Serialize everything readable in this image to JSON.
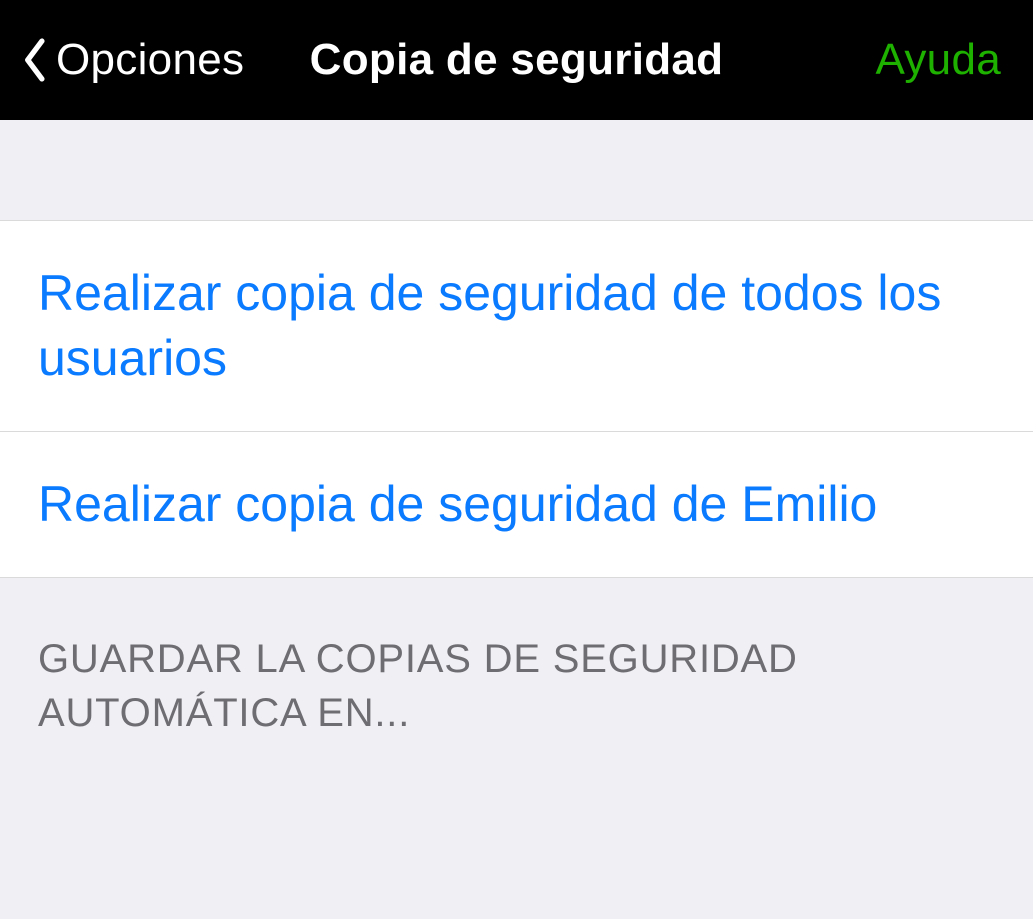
{
  "navbar": {
    "back_label": "Opciones",
    "title": "Copia de seguridad",
    "help_label": "Ayuda"
  },
  "actions": [
    {
      "label": "Realizar copia de seguridad de todos los usuarios"
    },
    {
      "label": "Realizar copia de seguridad de Emilio"
    }
  ],
  "section_header": "GUARDAR LA COPIAS DE SEGURIDAD AUTOMÁTICA EN..."
}
